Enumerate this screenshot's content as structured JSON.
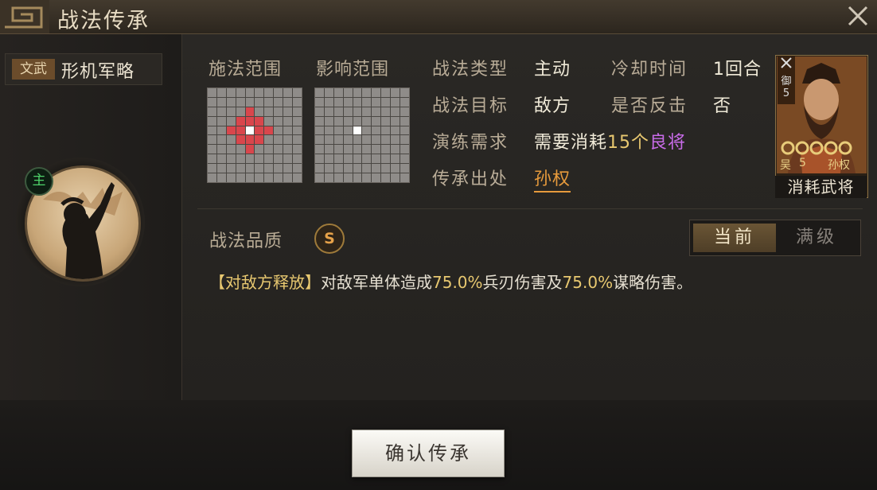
{
  "header": {
    "title": "战法传承"
  },
  "skill": {
    "tag": "文武",
    "name": "形机军略",
    "badge": "主"
  },
  "range": {
    "cast_label": "施法范围",
    "effect_label": "影响范围",
    "cast_grid": [
      "..........",
      "..........",
      "....r.....",
      "...rrr....",
      "..rrwrr...",
      "...rrr....",
      "....r.....",
      "..........",
      "..........",
      ".........."
    ],
    "effect_grid": [
      "..........",
      "..........",
      "..........",
      "..........",
      "....w.....",
      "..........",
      "..........",
      "..........",
      "..........",
      ".........."
    ]
  },
  "info": {
    "type_label": "战法类型",
    "type_value": "主动",
    "cooldown_label": "冷却时间",
    "cooldown_value": "1回合",
    "target_label": "战法目标",
    "target_value": "敌方",
    "counter_label": "是否反击",
    "counter_value": "否",
    "training_label": "演练需求",
    "training_prefix": "需要消耗",
    "training_count": "15个",
    "training_item": "良将",
    "origin_label": "传承出处",
    "origin_value": "孙权"
  },
  "card": {
    "faction": "吴",
    "level": "5",
    "name": "孙权",
    "role_char": "御",
    "role_num": "5",
    "stars": "ccccc",
    "label": "消耗武将"
  },
  "quality": {
    "label": "战法品质",
    "grade": "S"
  },
  "level_toggle": {
    "current": "当前",
    "max": "满级",
    "selected": "current"
  },
  "description": {
    "tag": "【对敌方释放】",
    "part1": "对敌军单体造成",
    "value1": "75.0%",
    "part2": "兵刃伤害及",
    "value2": "75.0%",
    "part3": "谋略伤害。"
  },
  "confirm_button": "确认传承",
  "colors": {
    "accent_gold": "#e8c870",
    "link_orange": "#e69a3c",
    "grid_red": "#d9464c",
    "rare_purple": "#c86be8"
  }
}
